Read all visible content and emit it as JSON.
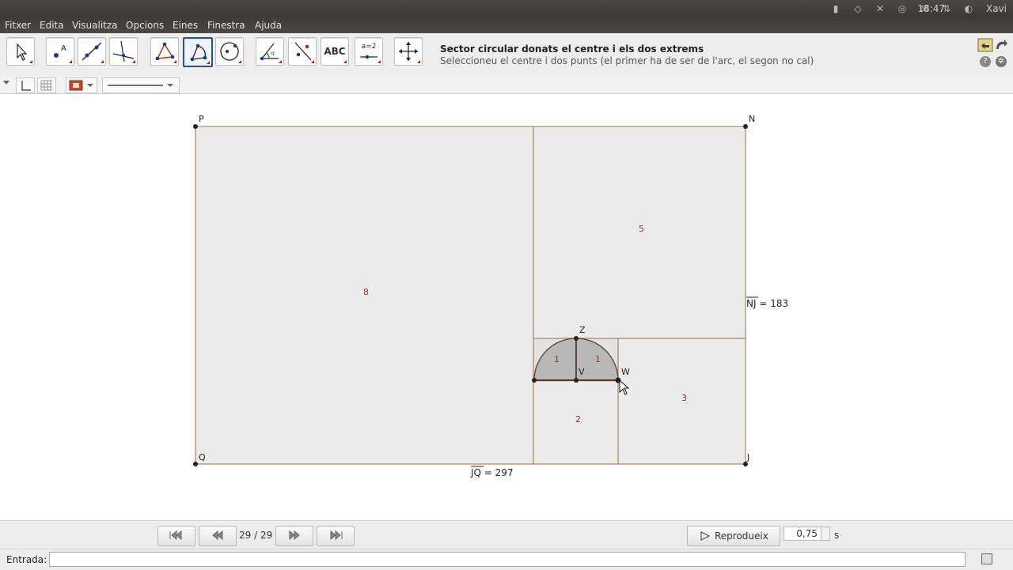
{
  "window": {
    "title": "",
    "clock": "18:47",
    "user": "Xavi"
  },
  "menu": [
    "Fitxer",
    "Edita",
    "Visualitza",
    "Opcions",
    "Eines",
    "Finestra",
    "Ajuda"
  ],
  "toolbar": {
    "text_tool_label": "ABC",
    "slider_tool_label": "a=2",
    "active_tool_title": "Sector circular donats el centre i els dos extrems",
    "active_tool_description": "Seleccioneu el centre i dos punts (el primer ha de ser de l'arc, el segon no cal)"
  },
  "construction": {
    "points": {
      "P": "P",
      "N": "N",
      "Q": "Q",
      "J": "J",
      "Z": "Z",
      "W": "W",
      "V": "V"
    },
    "region_labels": [
      "8",
      "5",
      "3",
      "2",
      "1",
      "1"
    ],
    "measure_nj": "NJ = 183",
    "measure_jq": "JQ = 297"
  },
  "playbar": {
    "step": "29 / 29",
    "play_label": "Reprodueix",
    "speed_value": "0,75",
    "speed_unit": "s"
  },
  "input": {
    "label": "Entrada:",
    "value": ""
  }
}
